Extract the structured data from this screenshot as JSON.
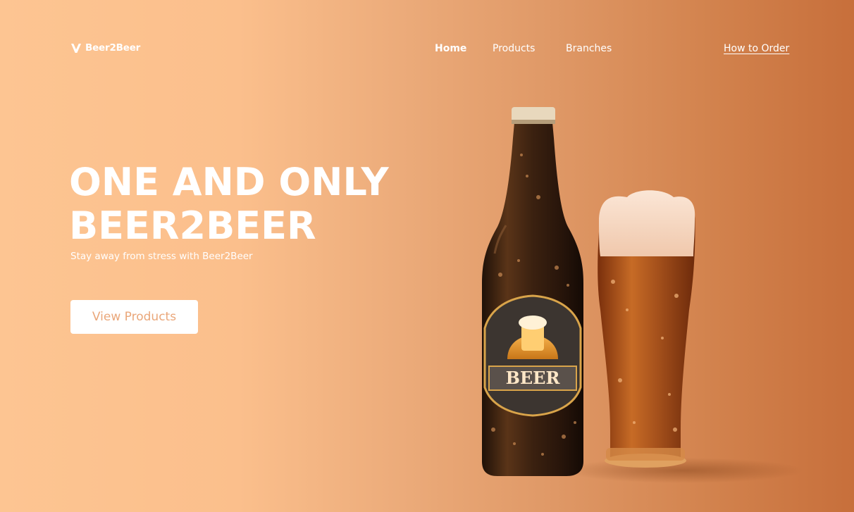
{
  "brand": {
    "name": "Beer2Beer",
    "logo_icon": "v-logo-icon"
  },
  "nav": {
    "items": [
      {
        "label": "Home",
        "active": true
      },
      {
        "label": "Products",
        "active": false
      },
      {
        "label": "Branches",
        "active": false
      }
    ],
    "cta_link": "How to Order"
  },
  "hero": {
    "title_line1": "ONE AND ONLY",
    "title_line2": "BEER2BEER",
    "subtitle": "Stay away from stress with Beer2Beer",
    "button_label": "View Products"
  },
  "product_image": {
    "label_text": "BEER"
  },
  "colors": {
    "gradient_start": "#fdc592",
    "gradient_end": "#c76f3b",
    "button_text": "#eaa77a",
    "bottle": "#3a2112",
    "beer": "#b9581f"
  }
}
